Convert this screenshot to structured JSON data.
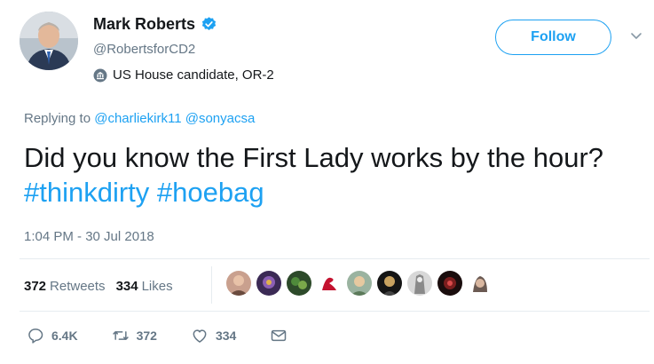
{
  "author": {
    "name": "Mark Roberts",
    "handle": "@RobertsforCD2",
    "bio_label": "US House candidate, OR-2"
  },
  "follow_button": "Follow",
  "reply": {
    "prefix": "Replying to",
    "mentions": [
      "@charliekirk11",
      "@sonyacsa"
    ]
  },
  "tweet": {
    "text": "Did you know the First Lady works by the hour?",
    "hashtags": [
      "#thinkdirty",
      "#hoebag"
    ]
  },
  "timestamp": "1:04 PM - 30 Jul 2018",
  "stats": {
    "retweets_count": "372",
    "retweets_label": "Retweets",
    "likes_count": "334",
    "likes_label": "Likes"
  },
  "actions": {
    "reply_count": "6.4K",
    "retweet_count": "372",
    "like_count": "334"
  },
  "colors": {
    "accent": "#1da1f2",
    "text": "#14171a",
    "muted": "#657786"
  },
  "icons": [
    "verified-badge-icon",
    "government-icon",
    "chevron-down-icon",
    "reply-icon",
    "retweet-icon",
    "heart-icon",
    "envelope-icon"
  ]
}
